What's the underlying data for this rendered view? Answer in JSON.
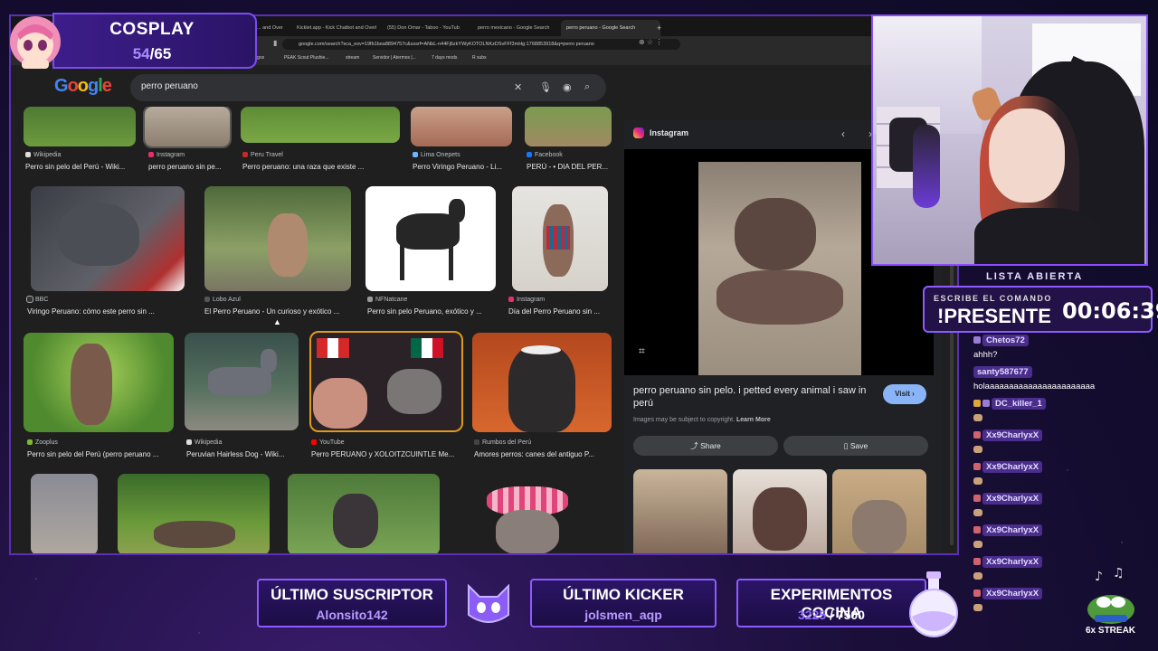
{
  "browser": {
    "tabs": [
      "... and Over",
      "Kicklet.app - Kick Chatbot and Overl",
      "(55) Don Omar - Taboo - YouTub",
      "perro mexicano - Google Search",
      "perro peruano - Google Search"
    ],
    "url": "google.com/search?sca_esv=19fb1bea8894757c&sxsrf=ANbL-n44Fj6zkYWyKOTOLNKzDSvFFf3mHg:1768853918&q=perro peruano",
    "bookmarks": [
      "Juegos",
      "PEAK Scout Plushie...",
      "stream",
      "Servidor | Atermos |...",
      "7 days mods",
      "R subs"
    ]
  },
  "search": {
    "logo_letters": [
      "G",
      "o",
      "o",
      "g",
      "l",
      "e"
    ],
    "query": "perro peruano"
  },
  "results": [
    {
      "source": "Wikipedia",
      "title": "Perro sin pelo del Perú - Wiki..."
    },
    {
      "source": "Instagram",
      "title": "perro peruano sin pe..."
    },
    {
      "source": "Peru Travel",
      "title": "Perro peruano: una raza que existe ..."
    },
    {
      "source": "Lima Onepets",
      "title": "Perro Viringo Peruano - Li..."
    },
    {
      "source": "Facebook",
      "title": "PERÚ - • DIA DEL PER..."
    },
    {
      "source": "BBC",
      "title": "Viringo Peruano: cómo este perro sin ..."
    },
    {
      "source": "Lobo Azul",
      "title": "El Perro Peruano - Un curioso y exótico ..."
    },
    {
      "source": "NFNatcane",
      "title": "Perro sin pelo Peruano, exótico y ..."
    },
    {
      "source": "Instagram",
      "title": "Día del Perro Peruano sin ..."
    },
    {
      "source": "Zooplus",
      "title": "Perro sin pelo del Perú (perro peruano ..."
    },
    {
      "source": "Wikipedia",
      "title": "Peruvian Hairless Dog - Wiki..."
    },
    {
      "source": "YouTube",
      "title": "Perro PERUANO y XOLOITZCUINTLE Me..."
    },
    {
      "source": "Rumbos del Perú",
      "title": "Amores perros: canes del antiguo P..."
    }
  ],
  "side_panel": {
    "brand": "Instagram",
    "caption": "perro peruano sin pelo. i petted every animal i saw in perú",
    "copyright": "Images may be subject to copyright.",
    "learn_more": "Learn More",
    "visit": "Visit ›",
    "share": "Share",
    "save": "Save"
  },
  "cosplay": {
    "title": "COSPLAY",
    "current": "54",
    "total": "/65"
  },
  "lista": "LISTA ABIERTA",
  "command": {
    "label": "ESCRIBE EL COMANDO",
    "command": "!PRESENTE",
    "timer": "00:06:39"
  },
  "chat": [
    {
      "user": "Chetos72",
      "text": "ahhh?"
    },
    {
      "user": "santy587677",
      "text": "holaaaaaaaaaaaaaaaaaaaaaaa"
    },
    {
      "user": "DC_killer_1",
      "text": ""
    },
    {
      "user": "Xx9CharlyxX",
      "text": ""
    },
    {
      "user": "Xx9CharlyxX",
      "text": ""
    },
    {
      "user": "Xx9CharlyxX",
      "text": ""
    },
    {
      "user": "Xx9CharlyxX",
      "text": ""
    },
    {
      "user": "Xx9CharlyxX",
      "text": ""
    },
    {
      "user": "Xx9CharlyxX",
      "text": ""
    }
  ],
  "streak": "6x STREAK",
  "panels": {
    "suscriptor": {
      "label": "ÚLTIMO SUSCRIPTOR",
      "value": "Alonsito142"
    },
    "kicker": {
      "label": "ÚLTIMO KICKER",
      "value": "jolsmen_aqp"
    },
    "cocina": {
      "label": "EXPERIMENTOS COCINA",
      "current": "3225",
      "total": " / 7500"
    }
  },
  "colors": {
    "accent": "#8f5bff",
    "google_blue": "#8ab4f8",
    "panel_bg": "#202124"
  }
}
